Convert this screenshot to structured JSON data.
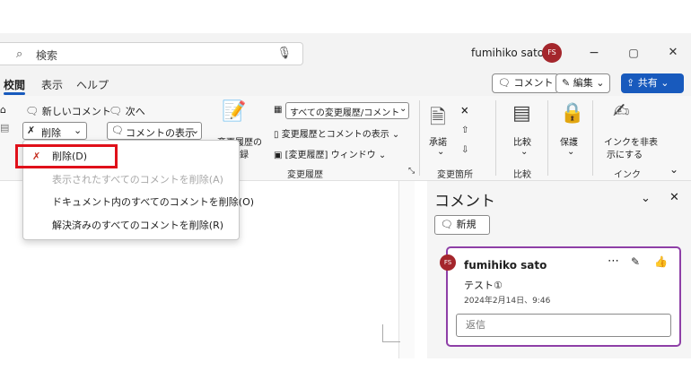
{
  "titlebar": {
    "search_icon": "search-icon",
    "search_label": "検索",
    "mic_icon": "mic-icon",
    "user_name": "fumihiko sato",
    "avatar_initials": "FS",
    "minimize": "−",
    "restore": "▢",
    "close": "✕"
  },
  "tabs": {
    "review": "校閲",
    "view": "表示",
    "help": "ヘルプ"
  },
  "top_buttons": {
    "comment": "コメント",
    "edit": "編集",
    "share": "共有"
  },
  "ribbon": {
    "new_comment": "新しいコメント",
    "next": "次へ",
    "delete": "削除",
    "show_comments": "コメントの表示",
    "track_changes": "変更履歴の",
    "track_changes_2": "録",
    "markup_select": "すべての変更履歴/コメント",
    "show_markup": "変更履歴とコメントの表示",
    "reviewing_pane": "[変更履歴] ウィンドウ",
    "group_tracking": "変更履歴",
    "accept": "承諾",
    "group_changes": "変更箇所",
    "compare": "比較",
    "group_compare": "比較",
    "protect": "保護",
    "hide_ink_1": "インクを非表",
    "hide_ink_2": "示にする",
    "group_ink": "インク"
  },
  "dropdown": {
    "delete": "削除(D)",
    "delete_shown": "表示されたすべてのコメントを削除(A)",
    "delete_all": "ドキュメント内のすべてのコメントを削除(O)",
    "delete_resolved": "解決済みのすべてのコメントを削除(R)"
  },
  "comments_pane": {
    "title": "コメント",
    "new_button": "新規",
    "card": {
      "author_initials": "FS",
      "author": "fumihiko sato",
      "text": "テスト①",
      "timestamp": "2024年2月14日、9:46",
      "reply_placeholder": "返信"
    }
  },
  "colors": {
    "accent": "#185abd",
    "highlight": "#e0101a",
    "card_border": "#8e3fa7",
    "avatar": "#a4262c"
  }
}
